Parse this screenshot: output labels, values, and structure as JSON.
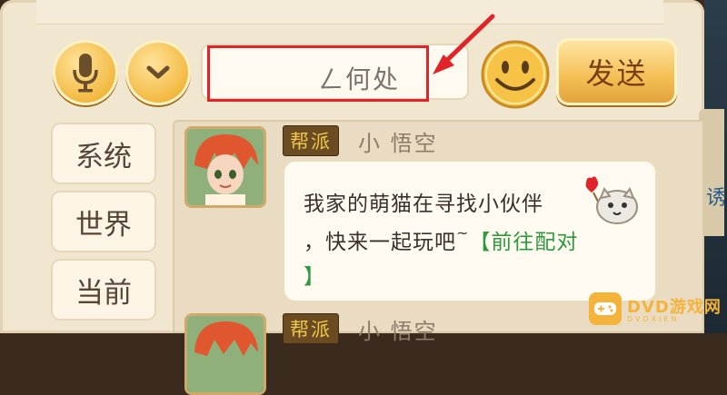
{
  "input": {
    "visible_text": "ㄥ何处"
  },
  "toolbar": {
    "send_label": "发送"
  },
  "tabs": [
    {
      "label": "系统"
    },
    {
      "label": "世界"
    },
    {
      "label": "当前"
    }
  ],
  "messages": [
    {
      "channel": "帮派",
      "sender": "小 悟空",
      "text_line1": "我家的萌猫在寻找小伙伴",
      "text_line2": "，快来一起玩吧",
      "tilde": "~",
      "link_open": "【前往配对",
      "link_close": "】"
    },
    {
      "channel": "帮派",
      "sender": "小 悟空"
    }
  ],
  "side_tab": {
    "text": "诱"
  },
  "watermark": {
    "title": "DVD游戏网",
    "subtitle": "DVDXIEN"
  },
  "colors": {
    "accent_gold": "#f2b73d",
    "link_green": "#2e9a3f",
    "highlight_red": "#e0242a"
  },
  "icons": [
    "microphone-icon",
    "chevron-down-icon",
    "smiley-icon",
    "red-arrow-annotation"
  ]
}
